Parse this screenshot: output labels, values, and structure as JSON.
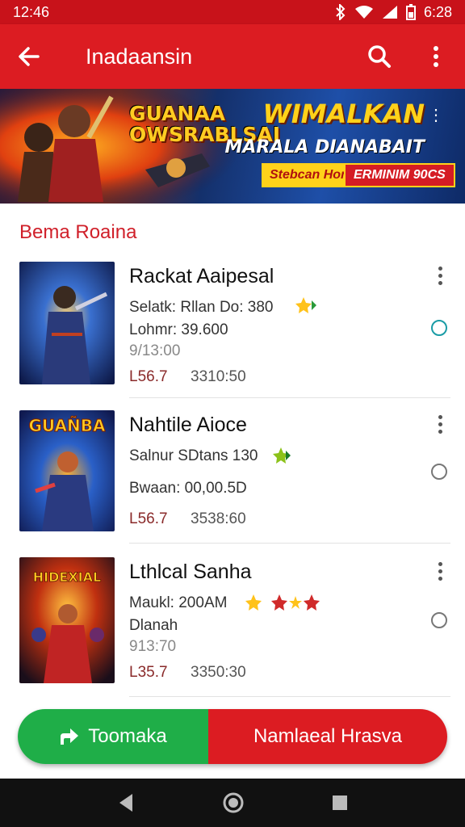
{
  "status": {
    "time": "12:46",
    "clock": "6:28"
  },
  "app_bar": {
    "title": "Inadaansin"
  },
  "banner": {
    "logo": "GUANAA OWSRABLSAI",
    "headline": "WIMALKAN",
    "subline": "MARALA DIANABAIT",
    "pill_a": "Stebcan Hom",
    "pill_b": "ERMINIM 90CS"
  },
  "section": {
    "title": "Bema Roaina"
  },
  "games": [
    {
      "name": "Rackat Aaipesal",
      "line1": "Selatk: Rllan Do: 380",
      "line2": "Lohmr: 39.600",
      "line3": "9/13:00",
      "left": "L56.7",
      "right": "3310:50",
      "selected": true
    },
    {
      "name": "Nahtile Aioce",
      "line1": "Salnur SDtans 130",
      "line2": "Bwaan: 00,00.5D",
      "line3": "",
      "left": "L56.7",
      "right": "3538:60",
      "selected": false
    },
    {
      "name": "Lthlcal Sanha",
      "line1": "Maukl: 200AM",
      "line2": "Dlanah",
      "line3": "913:70",
      "left": "L35.7",
      "right": "3350:30",
      "selected": false
    }
  ],
  "bottom": {
    "left_label": "Toomaka",
    "right_label": "Namlaeal Hrasva"
  },
  "colors": {
    "primary": "#dc1c22",
    "accent_green": "#1fae48",
    "section_title": "#d0202a",
    "radio_active": "#1a9ca6"
  }
}
